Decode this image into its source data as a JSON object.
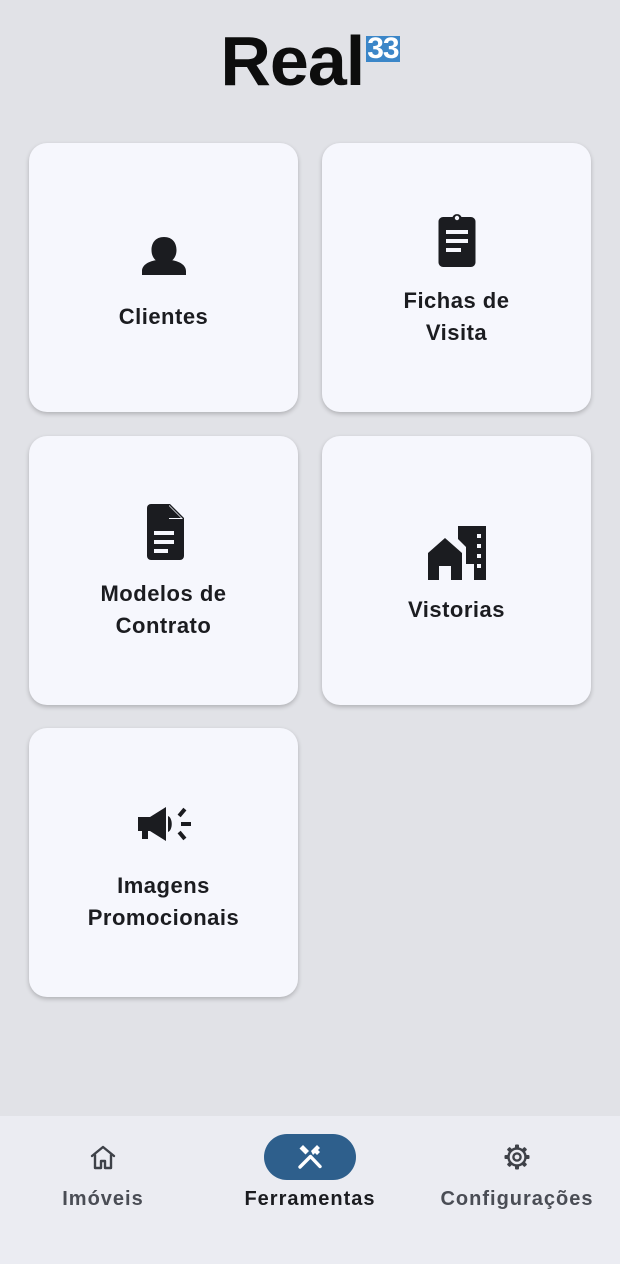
{
  "header": {
    "logo_text": "Real",
    "logo_badge": "33",
    "badge_color": "#3b86c8"
  },
  "tools": [
    {
      "label": "Clientes",
      "icon": "person-icon"
    },
    {
      "label": "Fichas de Visita",
      "icon": "clipboard-icon"
    },
    {
      "label": "Modelos de Contrato",
      "icon": "document-icon"
    },
    {
      "label": "Vistorias",
      "icon": "buildings-icon"
    },
    {
      "label": "Imagens Promocionais",
      "icon": "megaphone-icon"
    }
  ],
  "bottom_nav": {
    "active_color": "#2e5f8c",
    "items": [
      {
        "label": "Imóveis",
        "icon": "home-icon",
        "active": false
      },
      {
        "label": "Ferramentas",
        "icon": "tools-icon",
        "active": true
      },
      {
        "label": "Configurações",
        "icon": "gear-icon",
        "active": false
      }
    ]
  }
}
